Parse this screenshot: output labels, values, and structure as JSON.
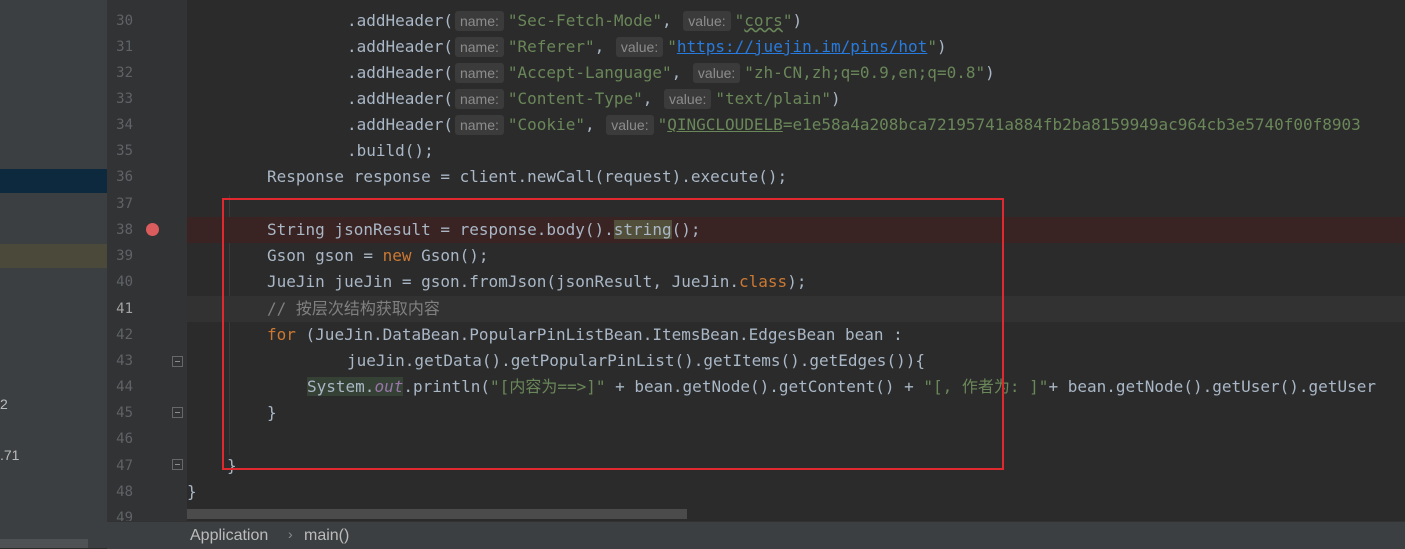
{
  "left_panel": {
    "fragment_1": "2",
    "fragment_2": ".71"
  },
  "gutter": {
    "line_numbers": [
      "30",
      "31",
      "32",
      "33",
      "34",
      "35",
      "36",
      "37",
      "38",
      "39",
      "40",
      "41",
      "42",
      "43",
      "44",
      "45",
      "46",
      "47",
      "48"
    ],
    "line_49_partial": "49"
  },
  "code": {
    "l30": {
      "method": ".addHeader(",
      "name_hint": "name:",
      "name_value": "\"Sec-Fetch-Mode\"",
      "value_hint": "value:",
      "value_prefix": "\"",
      "value_link": "cors",
      "value_suffix": "\"",
      "close": ")"
    },
    "l31": {
      "method": ".addHeader(",
      "name_hint": "name:",
      "name_value": "\"Referer\"",
      "value_hint": "value:",
      "value_prefix": "\"",
      "value_link": "https://juejin.im/pins/hot",
      "value_suffix": "\"",
      "close": ")"
    },
    "l32": {
      "method": ".addHeader(",
      "name_hint": "name:",
      "name_value": "\"Accept-Language\"",
      "value_hint": "value:",
      "value": "\"zh-CN,zh;q=0.9,en;q=0.8\"",
      "close": ")"
    },
    "l33": {
      "method": ".addHeader(",
      "name_hint": "name:",
      "name_value": "\"Content-Type\"",
      "value_hint": "value:",
      "value": "\"text/plain\"",
      "close": ")"
    },
    "l34": {
      "method": ".addHeader(",
      "name_hint": "name:",
      "name_value": "\"Cookie\"",
      "value_hint": "value:",
      "value_prefix": "\"",
      "value_link": "QINGCLOUDELB",
      "value_rest": "=e1e58a4a208bca72195741a884fb2ba8159949ac964cb3e5740f00f8903"
    },
    "l35": {
      "text": ".build();"
    },
    "l36": {
      "text": "Response response = client.newCall(request).execute();"
    },
    "l38": {
      "pre": "String jsonResult = response.body().",
      "mark": "string",
      "post": "();"
    },
    "l39": {
      "pre": "Gson gson = ",
      "kw": "new",
      "post": " Gson();"
    },
    "l40": {
      "pre": "JueJin jueJin = gson.fromJson(jsonResult, JueJin.",
      "kw": "class",
      "post": ");"
    },
    "l41": {
      "comment": "// 按层次结构获取内容"
    },
    "l42": {
      "kw": "for",
      "rest": " (JueJin.DataBean.PopularPinListBean.ItemsBean.EdgesBean bean :"
    },
    "l43": {
      "text": "jueJin.getData().getPopularPinList().getItems().getEdges()){"
    },
    "l44": {
      "system": "System",
      "dot": ".",
      "field": "out",
      "pre": ".println(",
      "str1": "\"[内容为==>]\"",
      "mid": " + bean.getNode().getContent() + ",
      "str2": "\"[, 作者为: ]\"",
      "post": "+ bean.getNode().getUser().getUser"
    },
    "l45": {
      "text": "}"
    },
    "l47": {
      "text": "}"
    },
    "l48": {
      "text": "}"
    }
  },
  "breadcrumb": {
    "class_name": "Application",
    "method_name": "main()"
  },
  "colors": {
    "keyword": "#cc7832",
    "string": "#6a8759",
    "comment": "#808080",
    "highlight_box": "#e0292f",
    "breakpoint": "#db5c5c"
  }
}
